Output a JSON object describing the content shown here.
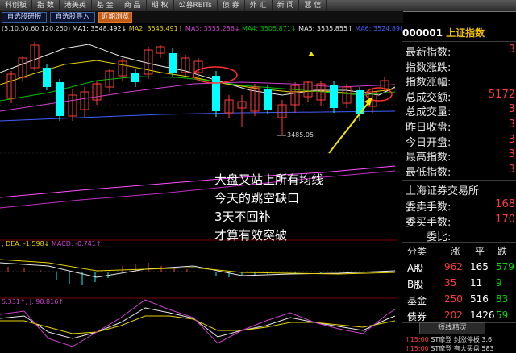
{
  "menu": {
    "items": [
      "科创板",
      "指 数",
      "港美英",
      "基 金",
      "商 品",
      "期 权",
      "公募REITs",
      "债 券",
      "外 汇",
      "新 闻",
      "慧 信"
    ]
  },
  "tabs": {
    "items": [
      "自选股研报",
      "自选股导入",
      "近期浏览"
    ],
    "active_index": 2
  },
  "ma_bar": {
    "prefix": "(5,10,30,60,120,250)",
    "ma1": "MA1: 3548.492↓",
    "ma2": "MA2: 3543.491↑",
    "ma3": "MA3: 3555.286↓",
    "ma4": "MA4: 3505.871↓",
    "ma5": "MA5: 3535.855↑",
    "ma6": "MA6: 3524.898"
  },
  "low_marker": "3485.05",
  "annotation": {
    "lines": [
      "大盘又站上所有均线",
      "今天的跳空缺口",
      "3天不回补",
      "才算有效突破"
    ]
  },
  "macd_bar": {
    "dea": ", DEA: -1.598↓",
    "macd": "MACD: -0.741↑"
  },
  "kdj_bar": {
    "text": "5.331↑, J: 90.816↑"
  },
  "panel": {
    "code": "000001",
    "name": "上证指数",
    "rows": [
      {
        "label": "最新指数:",
        "value": "3"
      },
      {
        "label": "指数涨跌:",
        "value": ""
      },
      {
        "label": "指数涨幅:",
        "value": ""
      },
      {
        "label": "总成交额:",
        "value": "5172"
      },
      {
        "label": "总成交量:",
        "value": "3"
      },
      {
        "label": "昨日收盘:",
        "value": "3"
      },
      {
        "label": "今日开盘:",
        "value": "3"
      },
      {
        "label": "最高指数:",
        "value": "3"
      },
      {
        "label": "最低指数:",
        "value": "3"
      }
    ],
    "exchange": "上海证券交易所",
    "sell_label": "委卖手数:",
    "sell_value": "168",
    "buy_label": "委买手数:",
    "buy_value": "170",
    "ratio_label": "委比:",
    "group_header": [
      "分类",
      "涨",
      "平",
      "跌"
    ],
    "groups": [
      {
        "name": "A股",
        "up": "962",
        "flat": "165",
        "down": "579"
      },
      {
        "name": "B股",
        "up": "35",
        "flat": "11",
        "down": "9"
      },
      {
        "name": "基金",
        "up": "250",
        "flat": "516",
        "down": "83"
      },
      {
        "name": "债券",
        "up": "202",
        "flat": "1426",
        "down": "59"
      }
    ],
    "short_button": "短线精灵",
    "alerts": [
      {
        "time": "↑15:00",
        "text": "ST摩登 封涨停板 3.6"
      },
      {
        "time": "↑15:00",
        "text": "ST摩登 有大买盘 583"
      }
    ]
  },
  "colors": {
    "up": "#ff3b3b",
    "down": "#00dd00",
    "cyan_candle": "#00ffff",
    "annotation_arrow": "#f2e600",
    "circle": "#ff3030"
  }
}
